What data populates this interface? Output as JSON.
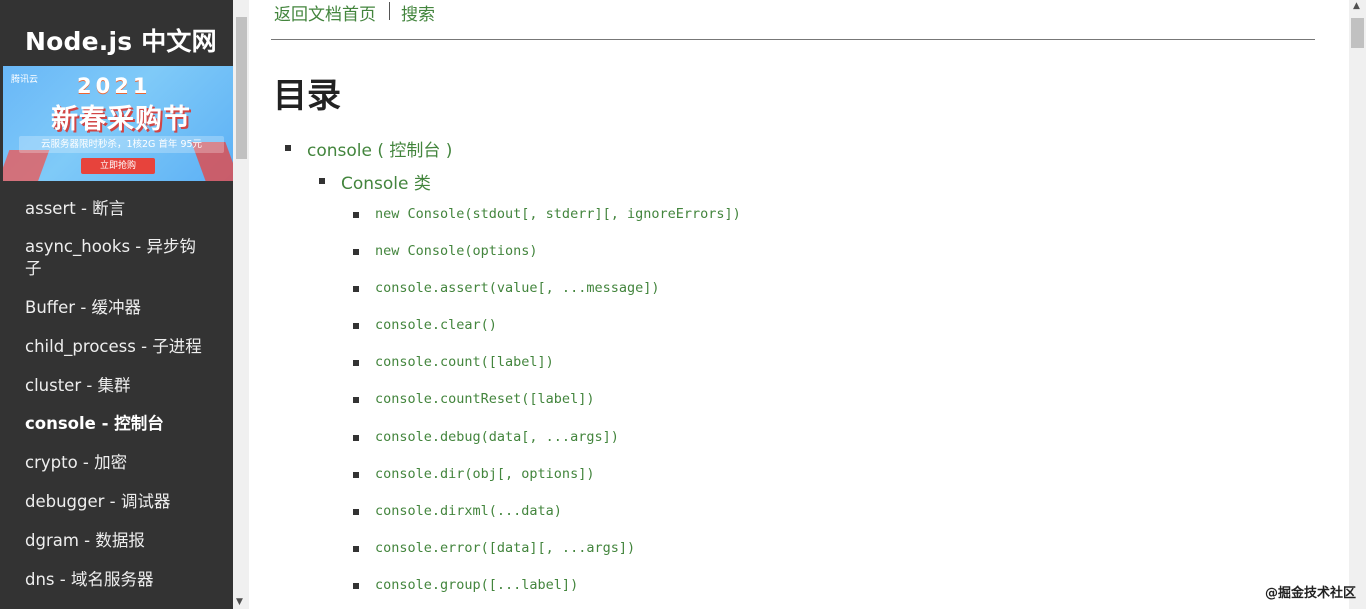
{
  "sidebar": {
    "brand": "Node.js 中文网",
    "banner": {
      "cloud_logo": "腾讯云",
      "year": "2021",
      "title": "新春采购节",
      "subtitle": "云服务器限时秒杀，1核2G 首年 95元",
      "button": "立即抢购"
    },
    "items": [
      {
        "label": "assert - 断言"
      },
      {
        "label": "async_hooks - 异步钩子"
      },
      {
        "label": "Buffer - 缓冲器"
      },
      {
        "label": "child_process - 子进程"
      },
      {
        "label": "cluster - 集群"
      },
      {
        "label": "console - 控制台"
      },
      {
        "label": "crypto - 加密"
      },
      {
        "label": "debugger - 调试器"
      },
      {
        "label": "dgram - 数据报"
      },
      {
        "label": "dns - 域名服务器"
      }
    ]
  },
  "topnav": {
    "home": "返回文档首页",
    "search": "搜索"
  },
  "toc": {
    "title": "目录",
    "level1": "console ( 控制台 )",
    "level2": "Console 类",
    "items": [
      "new Console(stdout[, stderr][, ignoreErrors])",
      "new Console(options)",
      "console.assert(value[, ...message])",
      "console.clear()",
      "console.count([label])",
      "console.countReset([label])",
      "console.debug(data[, ...args])",
      "console.dir(obj[, options])",
      "console.dirxml(...data)",
      "console.error([data][, ...args])",
      "console.group([...label])"
    ]
  },
  "watermark": "@掘金技术社区",
  "colors": {
    "sidebar_bg": "#333333",
    "link": "#43853d"
  }
}
